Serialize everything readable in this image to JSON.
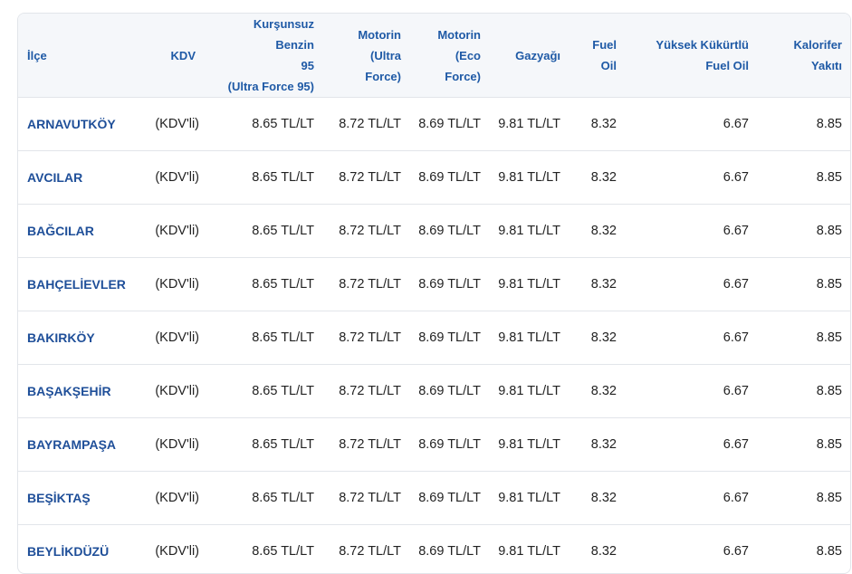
{
  "columns": [
    {
      "key": "district",
      "lines": [
        "İlçe"
      ]
    },
    {
      "key": "kdv",
      "lines": [
        "KDV"
      ]
    },
    {
      "key": "benzin95",
      "lines": [
        "Kurşunsuz Benzin",
        "95",
        "(Ultra Force 95)"
      ]
    },
    {
      "key": "motorin_ultra",
      "lines": [
        "Motorin",
        "(Ultra",
        "Force)"
      ]
    },
    {
      "key": "motorin_eco",
      "lines": [
        "Motorin",
        "(Eco",
        "Force)"
      ]
    },
    {
      "key": "gazyagi",
      "lines": [
        "Gazyağı"
      ]
    },
    {
      "key": "fuel_oil",
      "lines": [
        "Fuel",
        "Oil"
      ]
    },
    {
      "key": "yuksek_kukurtlu",
      "lines": [
        "Yüksek Kükürtlü",
        "Fuel Oil"
      ]
    },
    {
      "key": "kalorifer",
      "lines": [
        "Kalorifer",
        "Yakıtı"
      ]
    }
  ],
  "rows": [
    {
      "district": "ARNAVUTKÖY",
      "kdv": "(KDV'li)",
      "benzin95": "8.65 TL/LT",
      "motorin_ultra": "8.72 TL/LT",
      "motorin_eco": "8.69 TL/LT",
      "gazyagi": "9.81 TL/LT",
      "fuel_oil": "8.32",
      "yuksek_kukurtlu": "6.67",
      "kalorifer": "8.85"
    },
    {
      "district": "AVCILAR",
      "kdv": "(KDV'li)",
      "benzin95": "8.65 TL/LT",
      "motorin_ultra": "8.72 TL/LT",
      "motorin_eco": "8.69 TL/LT",
      "gazyagi": "9.81 TL/LT",
      "fuel_oil": "8.32",
      "yuksek_kukurtlu": "6.67",
      "kalorifer": "8.85"
    },
    {
      "district": "BAĞCILAR",
      "kdv": "(KDV'li)",
      "benzin95": "8.65 TL/LT",
      "motorin_ultra": "8.72 TL/LT",
      "motorin_eco": "8.69 TL/LT",
      "gazyagi": "9.81 TL/LT",
      "fuel_oil": "8.32",
      "yuksek_kukurtlu": "6.67",
      "kalorifer": "8.85"
    },
    {
      "district": "BAHÇELİEVLER",
      "kdv": "(KDV'li)",
      "benzin95": "8.65 TL/LT",
      "motorin_ultra": "8.72 TL/LT",
      "motorin_eco": "8.69 TL/LT",
      "gazyagi": "9.81 TL/LT",
      "fuel_oil": "8.32",
      "yuksek_kukurtlu": "6.67",
      "kalorifer": "8.85"
    },
    {
      "district": "BAKIRKÖY",
      "kdv": "(KDV'li)",
      "benzin95": "8.65 TL/LT",
      "motorin_ultra": "8.72 TL/LT",
      "motorin_eco": "8.69 TL/LT",
      "gazyagi": "9.81 TL/LT",
      "fuel_oil": "8.32",
      "yuksek_kukurtlu": "6.67",
      "kalorifer": "8.85"
    },
    {
      "district": "BAŞAKŞEHİR",
      "kdv": "(KDV'li)",
      "benzin95": "8.65 TL/LT",
      "motorin_ultra": "8.72 TL/LT",
      "motorin_eco": "8.69 TL/LT",
      "gazyagi": "9.81 TL/LT",
      "fuel_oil": "8.32",
      "yuksek_kukurtlu": "6.67",
      "kalorifer": "8.85"
    },
    {
      "district": "BAYRAMPAŞA",
      "kdv": "(KDV'li)",
      "benzin95": "8.65 TL/LT",
      "motorin_ultra": "8.72 TL/LT",
      "motorin_eco": "8.69 TL/LT",
      "gazyagi": "9.81 TL/LT",
      "fuel_oil": "8.32",
      "yuksek_kukurtlu": "6.67",
      "kalorifer": "8.85"
    },
    {
      "district": "BEŞİKTAŞ",
      "kdv": "(KDV'li)",
      "benzin95": "8.65 TL/LT",
      "motorin_ultra": "8.72 TL/LT",
      "motorin_eco": "8.69 TL/LT",
      "gazyagi": "9.81 TL/LT",
      "fuel_oil": "8.32",
      "yuksek_kukurtlu": "6.67",
      "kalorifer": "8.85"
    },
    {
      "district": "BEYLİKDÜZÜ",
      "kdv": "(KDV'li)",
      "benzin95": "8.65 TL/LT",
      "motorin_ultra": "8.72 TL/LT",
      "motorin_eco": "8.69 TL/LT",
      "gazyagi": "9.81 TL/LT",
      "fuel_oil": "8.32",
      "yuksek_kukurtlu": "6.67",
      "kalorifer": "8.85"
    }
  ],
  "colors": {
    "header_text": "#1f5aa6",
    "district_link": "#1f4f99",
    "header_bg": "#f5f7fa",
    "border": "#e2e5ea"
  }
}
